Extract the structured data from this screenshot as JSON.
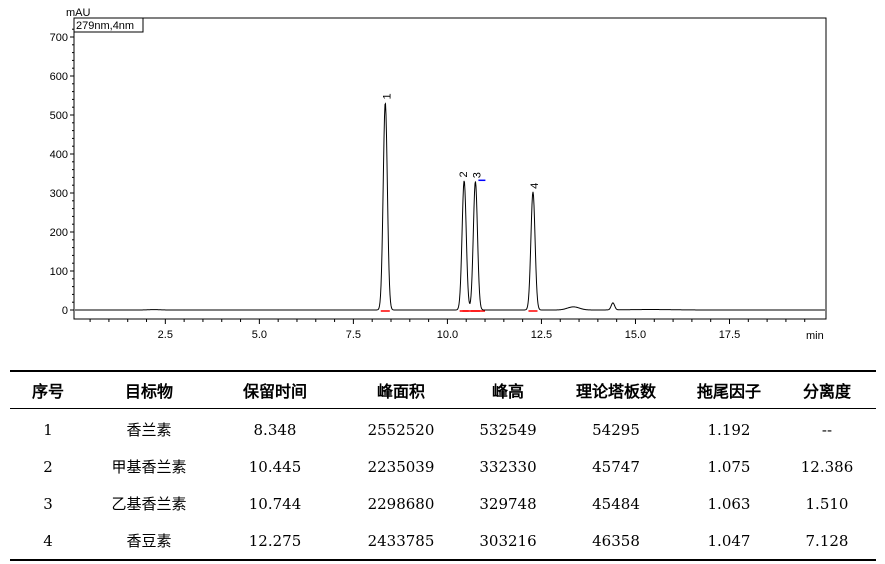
{
  "chart_data": {
    "type": "line",
    "ylabel": "mAU",
    "xlabel": "min",
    "trace_label": "279nm,4nm",
    "xlim": [
      0,
      20.0
    ],
    "ylim": [
      -20,
      730
    ],
    "xticks": [
      2.5,
      5.0,
      7.5,
      10.0,
      12.5,
      15.0,
      17.5
    ],
    "xtick_labels": [
      "2.5",
      "5.0",
      "7.5",
      "10.0",
      "12.5",
      "15.0",
      "17.5"
    ],
    "yticks": [
      0,
      100,
      200,
      300,
      400,
      500,
      600,
      700
    ],
    "ytick_labels": [
      "0",
      "100",
      "200",
      "300",
      "400",
      "500",
      "600",
      "700"
    ],
    "peaks": [
      {
        "label": "1",
        "x": 8.348,
        "y": 532
      },
      {
        "label": "2",
        "x": 10.445,
        "y": 332
      },
      {
        "label": "3",
        "x": 10.744,
        "y": 330
      },
      {
        "label": "4",
        "x": 12.275,
        "y": 303
      }
    ],
    "minor_peaks": [
      {
        "x": 2.2,
        "y": 1
      },
      {
        "x": 13.35,
        "y": 8
      },
      {
        "x": 14.4,
        "y": 18
      }
    ]
  },
  "table": {
    "headers": [
      "序号",
      "目标物",
      "保留时间",
      "峰面积",
      "峰高",
      "理论塔板数",
      "拖尾因子",
      "分离度"
    ],
    "rows": [
      [
        "1",
        "香兰素",
        "8.348",
        "2552520",
        "532549",
        "54295",
        "1.192",
        "--"
      ],
      [
        "2",
        "甲基香兰素",
        "10.445",
        "2235039",
        "332330",
        "45747",
        "1.075",
        "12.386"
      ],
      [
        "3",
        "乙基香兰素",
        "10.744",
        "2298680",
        "329748",
        "45484",
        "1.063",
        "1.510"
      ],
      [
        "4",
        "香豆素",
        "12.275",
        "2433785",
        "303216",
        "46358",
        "1.047",
        "7.128"
      ]
    ]
  },
  "colors": {
    "trace": "#000000",
    "baseline_marker": "#ff0000",
    "marker_blue": "#0000ff"
  }
}
